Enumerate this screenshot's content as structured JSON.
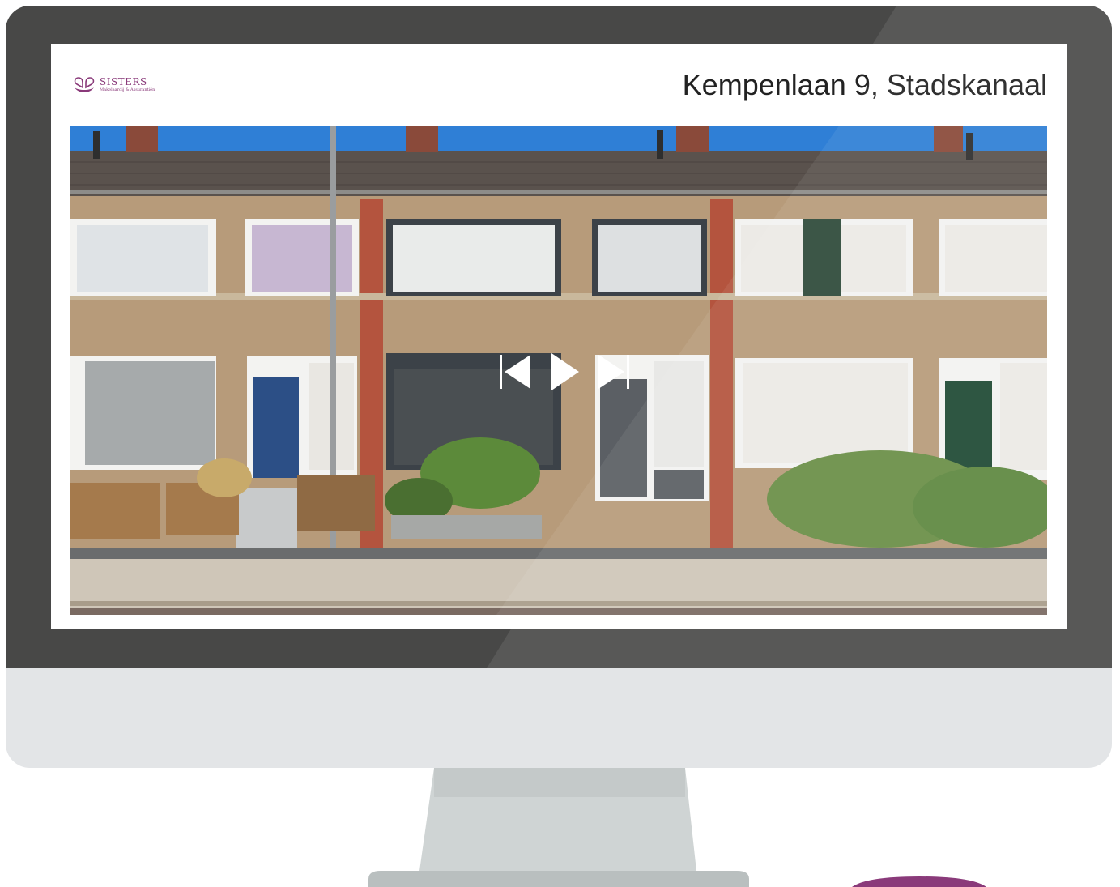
{
  "listing": {
    "brand_name": "SISTERS",
    "brand_tagline": "Makelaardij & Assurantiën",
    "address": "Kempenlaan 9, Stadskanaal"
  },
  "player": {
    "controls": [
      {
        "name": "previous",
        "icon": "skip-back-icon"
      },
      {
        "name": "play",
        "icon": "play-icon"
      },
      {
        "name": "next",
        "icon": "skip-forward-icon"
      }
    ]
  },
  "colors": {
    "bezel": "#484847",
    "monitor_body": "#e3e5e7",
    "stand": "#cfd4d4",
    "brand": "#8a3a7a"
  }
}
